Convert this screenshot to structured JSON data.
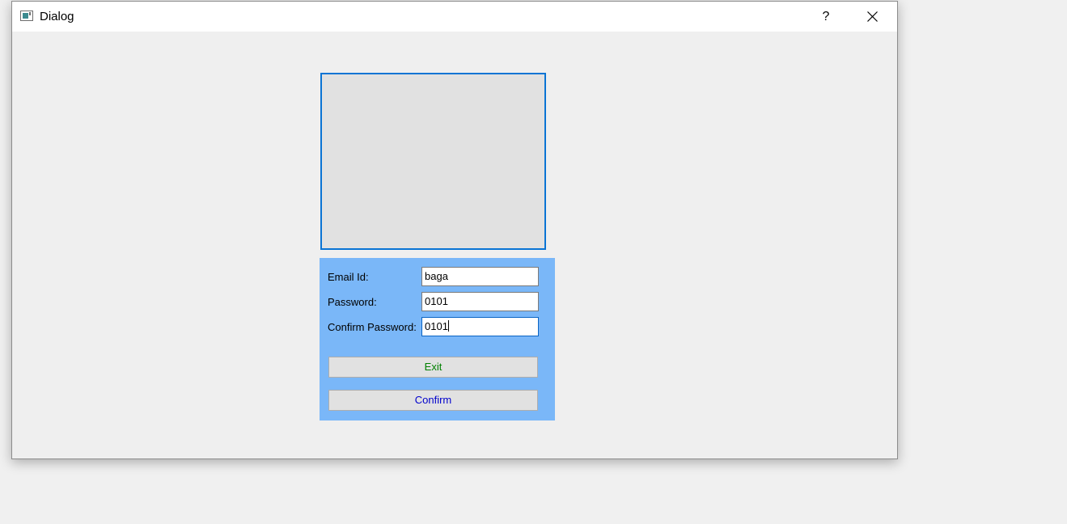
{
  "window": {
    "title": "Dialog",
    "help_label": "?"
  },
  "form": {
    "email_label": "Email Id:",
    "email_value": "baga",
    "password_label": "Password:",
    "password_value": "0101",
    "confirm_password_label": "Confirm Password:",
    "confirm_password_value": "0101",
    "exit_label": "Exit",
    "confirm_label": "Confirm"
  },
  "colors": {
    "panel_bg": "#7ab7f8",
    "exit_text": "#008000",
    "confirm_text": "#0000cc",
    "frame_border": "#0a74d4"
  },
  "icons": {
    "window_icon": "app-window-icon",
    "close_icon": "close-icon"
  }
}
